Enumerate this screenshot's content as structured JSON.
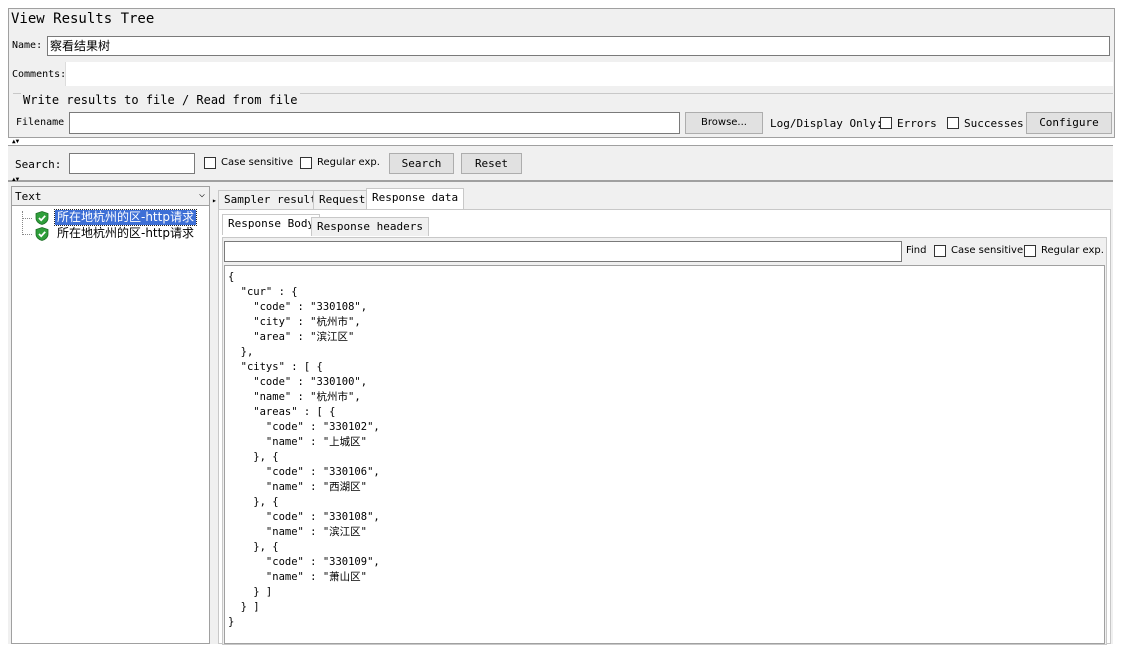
{
  "window": {
    "title": "View Results Tree"
  },
  "name_field": {
    "label": "Name:",
    "value": "察看结果树"
  },
  "comments": {
    "label": "Comments:"
  },
  "file_section": {
    "legend": "Write results to file / Read from file",
    "filename_label": "Filename",
    "browse_label": "Browse...",
    "log_display_label": "Log/Display Only:",
    "errors_label": "Errors",
    "successes_label": "Successes",
    "configure_label": "Configure"
  },
  "search": {
    "label": "Search:",
    "case_sensitive_label": "Case sensitive",
    "regex_label": "Regular exp.",
    "search_button": "Search",
    "reset_button": "Reset"
  },
  "renderer": {
    "selected": "Text"
  },
  "tree": {
    "items": [
      {
        "label": "所在地杭州的区-http请求",
        "status": "success",
        "selected": true
      },
      {
        "label": "所在地杭州的区-http请求",
        "status": "success",
        "selected": false
      }
    ]
  },
  "tabs": {
    "sampler_result": "Sampler result",
    "request": "Request",
    "response_data": "Response data"
  },
  "subtabs": {
    "response_body": "Response Body",
    "response_headers": "Response headers"
  },
  "find": {
    "label": "Find",
    "case_sensitive_label": "Case sensitive",
    "regex_label": "Regular exp."
  },
  "response_body": "{\n  \"cur\" : {\n    \"code\" : \"330108\",\n    \"city\" : \"杭州市\",\n    \"area\" : \"滨江区\"\n  },\n  \"citys\" : [ {\n    \"code\" : \"330100\",\n    \"name\" : \"杭州市\",\n    \"areas\" : [ {\n      \"code\" : \"330102\",\n      \"name\" : \"上城区\"\n    }, {\n      \"code\" : \"330106\",\n      \"name\" : \"西湖区\"\n    }, {\n      \"code\" : \"330108\",\n      \"name\" : \"滨江区\"\n    }, {\n      \"code\" : \"330109\",\n      \"name\" : \"萧山区\"\n    } ]\n  } ]\n}",
  "colors": {
    "selection": "#3d6fd6",
    "success_icon": "#2e9e3a",
    "panel_bg": "#f0f0f0"
  },
  "icons": {
    "tree_status": "shield-check-icon"
  }
}
